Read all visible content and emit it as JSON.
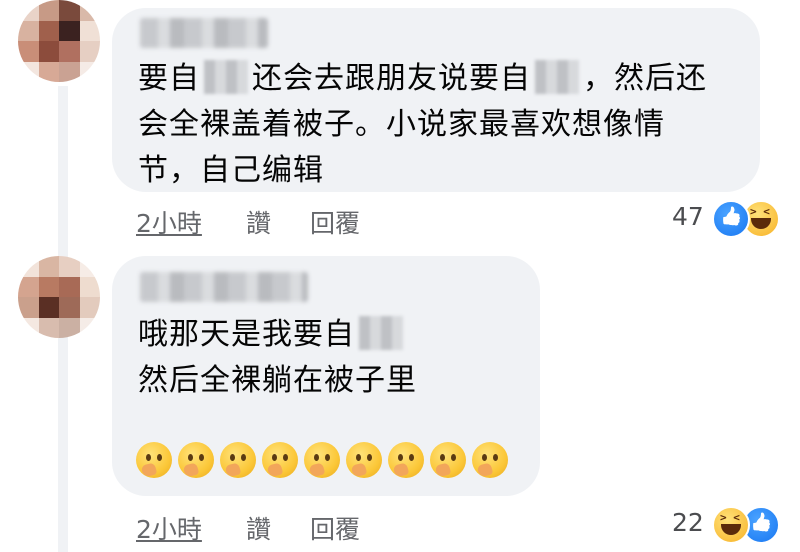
{
  "comments": [
    {
      "lines": [
        {
          "before": "要自",
          "after": "还会去跟朋友说要自",
          "tail": "，然后还"
        },
        {
          "text": "会全裸盖着被子。小说家最喜欢想像情"
        },
        {
          "text": "节，自己编辑"
        }
      ],
      "time": "2小時",
      "like_label": "讚",
      "reply_label": "回覆",
      "reaction_count": "47",
      "reactions": [
        "like-icon",
        "haha-icon"
      ]
    },
    {
      "lines": [
        {
          "before": "哦那天是我要自"
        },
        {
          "text": "然后全裸躺在被子里"
        }
      ],
      "emoji": "thinking-face-emoji",
      "emoji_count": 9,
      "time": "2小時",
      "like_label": "讚",
      "reply_label": "回覆",
      "reaction_count": "22",
      "reactions": [
        "haha-icon",
        "like-icon"
      ]
    }
  ],
  "colors": {
    "bubble": "#f0f2f5",
    "meta_text": "#65676b",
    "like_blue": "#1877f2",
    "haha_yellow": "#f7b125"
  }
}
